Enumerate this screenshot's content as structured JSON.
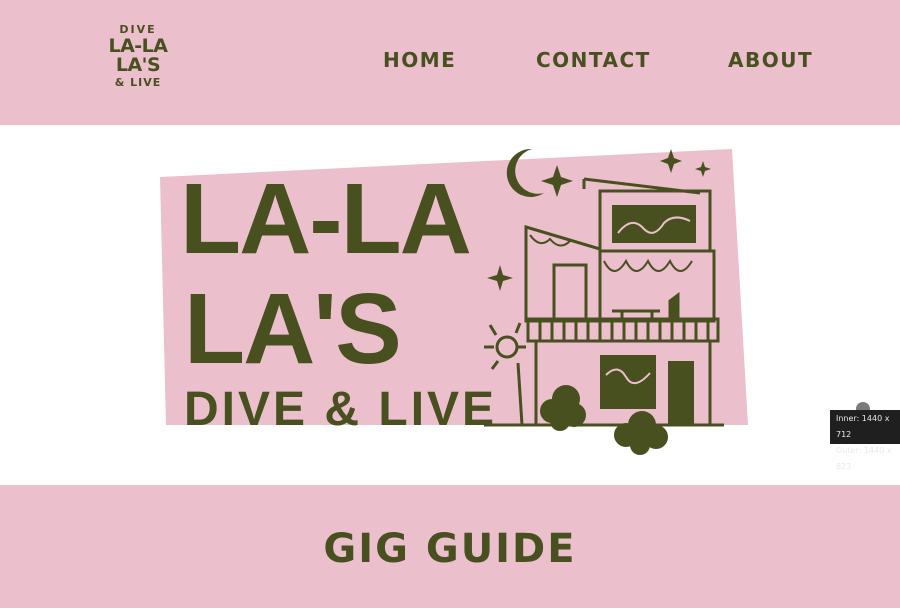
{
  "logo": {
    "line1": "DIVE",
    "line2": "LA-LA",
    "line3": "LA'S",
    "line4": "& LIVE"
  },
  "nav": {
    "home": "HOME",
    "contact": "CONTACT",
    "about": "ABOUT"
  },
  "hero": {
    "title_line1": "LA-LA",
    "title_line2": "LA'S",
    "subtitle": "DIVE & LIVE"
  },
  "gig_guide": {
    "title": "GIG GUIDE"
  },
  "devtools": {
    "inner": "Inner: 1440 x 712",
    "outer": "Outer: 1440 x 823"
  },
  "colors": {
    "pink": "#ecbfcc",
    "olive": "#48501f",
    "white": "#ffffff"
  }
}
